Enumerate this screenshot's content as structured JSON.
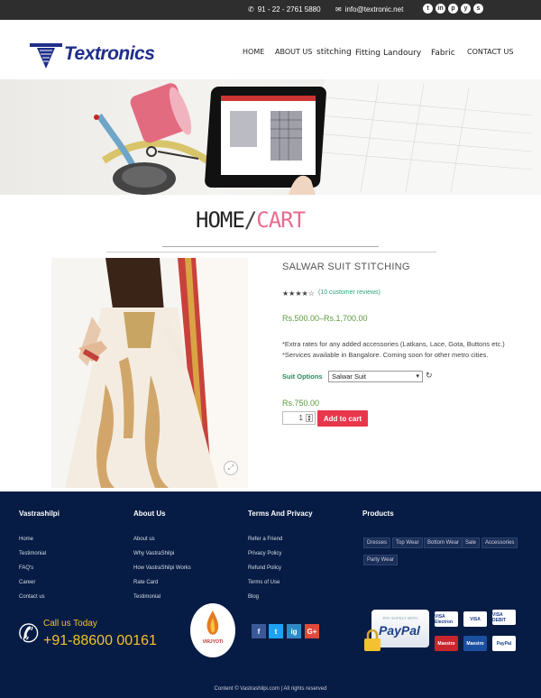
{
  "topbar": {
    "phone": "91 - 22 - 2761 5880",
    "email": "info@textronic.net",
    "social_icons": [
      "twitter-icon",
      "linkedin-icon",
      "pinterest-icon",
      "yelp-icon",
      "skype-icon"
    ]
  },
  "header": {
    "logo_text": "Textronics",
    "nav": [
      "HOME",
      "ABOUT US",
      "stitching",
      "Fitting",
      "Landoury",
      "Fabric",
      "CONTACT US"
    ]
  },
  "page_title": {
    "home": "HOME",
    "separator": "/",
    "cart": "CART"
  },
  "product": {
    "title": "SALWAR SUIT STITCHING",
    "rating": 4,
    "rating_max": 5,
    "reviews": "(10 customer reviews)",
    "price_range": "Rs.500.00–Rs.1,700.00",
    "note_line1": "*Extra rates for any added accessories (Latkans, Lace, Gota, Buttons etc.)",
    "note_line2": "*Services available in Bangalore. Coming soon for other metro cities.",
    "option_label": "Suit Options",
    "option_value": "Salwar Suit",
    "price": "Rs.750.00",
    "quantity": "1",
    "add_to_cart": "Add to cart"
  },
  "footer": {
    "col1": {
      "heading": "Vastrashilpi",
      "links": [
        "Home",
        "Testimonial",
        "FAQ's",
        "Career",
        "Contact us"
      ]
    },
    "col2": {
      "heading": "About Us",
      "links": [
        "About us",
        "Why VastraShilpi",
        "How VastraShilpi Works",
        "Rate Card",
        "Testimonial"
      ]
    },
    "col3": {
      "heading": "Terms And Privacy",
      "links": [
        "Refer a Friend",
        "Privacy Policy",
        "Refund Policy",
        "Terms of Use",
        "Blog"
      ]
    },
    "col4": {
      "heading": "Products",
      "tags": [
        "Dresses",
        "Top Wear",
        "Bottom Wear",
        "Sale",
        "Accessories",
        "Party Wear"
      ]
    },
    "call_label": "Call us Today",
    "call_number": "+91-88600 00161",
    "brand_name": "VIRJYOTI",
    "social": [
      "f",
      "t",
      "ig",
      "G+"
    ],
    "paypal_safe": "PAY SAFELY WITH",
    "paypal": "PayPal",
    "cards": [
      "VISA Electron",
      "VISA",
      "VISA DEBIT",
      "Maestro",
      "Maestro",
      "PayPal"
    ],
    "copyright": "Content © Vastrashilpi.com | All rights reserved"
  },
  "colors": {
    "accent_pink": "#e86b8f",
    "add_to_cart": "#e8374b",
    "footer_bg": "#061c44",
    "call_yellow": "#f5c22c",
    "link_green": "#30a27a"
  }
}
